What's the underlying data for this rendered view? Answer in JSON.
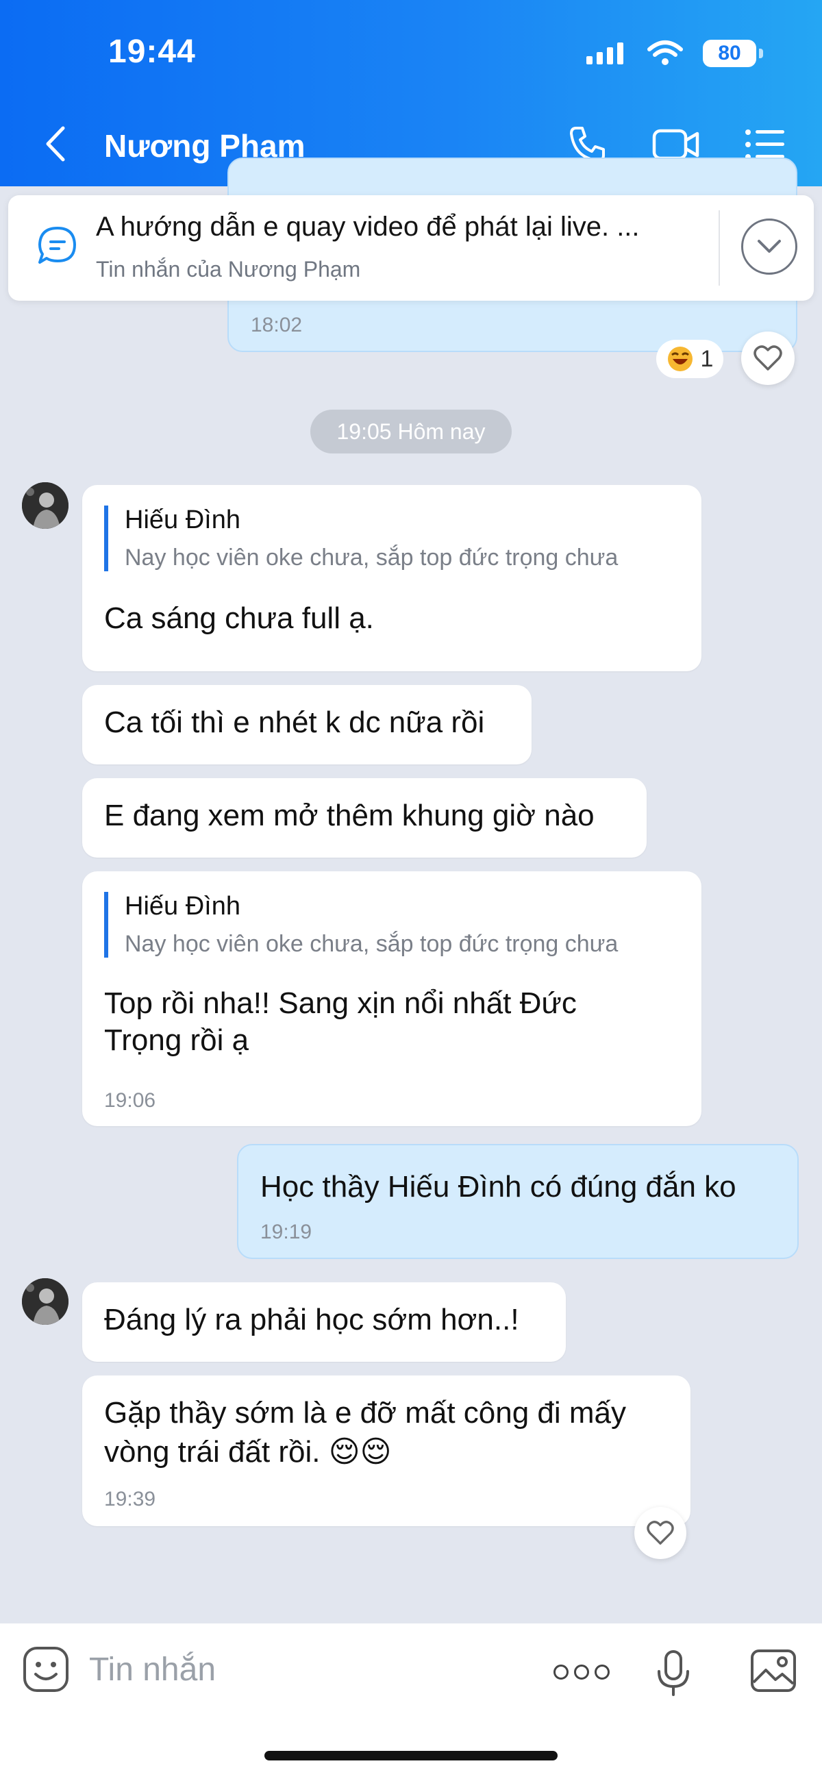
{
  "status": {
    "time": "19:44",
    "battery": "80"
  },
  "header": {
    "title": "Nương Phạm",
    "back_label": "back"
  },
  "pinned": {
    "text": "A hướng dẫn e quay video để phát lại live. ...",
    "sub": "Tin nhắn của Nương Phạm"
  },
  "messages": {
    "m0_time": "18:02",
    "reaction_count": "1",
    "date_pill": "19:05 Hôm nay",
    "m1_quote_name": "Hiếu Đình",
    "m1_quote_text": "Nay học viên oke chưa, sắp top đức trọng chưa",
    "m1_text": "Ca sáng chưa full ạ.",
    "m2_text": "Ca tối thì e nhét k dc nữa rồi",
    "m3_text": "E đang xem mở thêm khung giờ nào",
    "m4_quote_name": "Hiếu Đình",
    "m4_quote_text": "Nay học viên oke chưa, sắp top đức trọng chưa",
    "m4_line1": "Top rồi nha!! Sang xịn nổi nhất Đức",
    "m4_line2": "Trọng rồi ạ",
    "m4_time": "19:06",
    "m5_text": "Học thầy Hiếu Đình có đúng đắn ko",
    "m5_time": "19:19",
    "m6_text": "Đáng lý ra phải học sớm hơn..!",
    "m7_line1": "Gặp thầy sớm là e đỡ mất công đi mấy",
    "m7_line2": "vòng trái đất rồi. 😌😌",
    "m7_time": "19:39"
  },
  "composer": {
    "placeholder": "Tin nhắn"
  }
}
